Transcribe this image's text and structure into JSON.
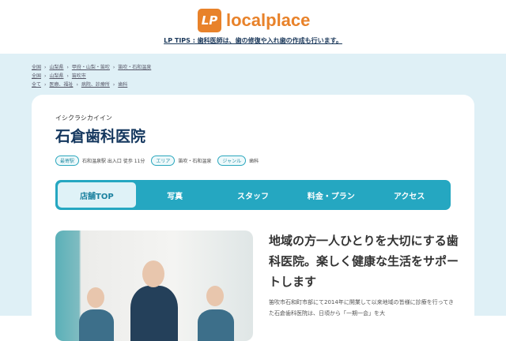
{
  "header": {
    "logo_mark": "LP",
    "logo_text": "localplace",
    "tips": "LP TIPS : 歯科医師は、歯の修復や入れ歯の作成も行います。"
  },
  "breadcrumbs": [
    [
      "全国",
      "山梨県",
      "甲府・山梨・笛吹",
      "笛吹・石和温泉"
    ],
    [
      "全国",
      "山梨県",
      "笛吹市"
    ],
    [
      "全て",
      "医療、福祉",
      "病院、診療所",
      "歯科"
    ]
  ],
  "clinic": {
    "kana": "イシクラシカイイン",
    "name": "石倉歯科医院",
    "tags": [
      {
        "label": "最寄駅",
        "value": "石和温泉駅 出入口 徒歩 11分"
      },
      {
        "label": "エリア",
        "value": "笛吹・石和温泉"
      },
      {
        "label": "ジャンル",
        "value": "歯科"
      }
    ]
  },
  "nav": [
    "店舗TOP",
    "写真",
    "スタッフ",
    "料金・プラン",
    "アクセス"
  ],
  "content": {
    "headline": "地域の方一人ひとりを大切にする歯科医院。楽しく健康な生活をサポートします",
    "description": "笛吹市石和町市部にて2014年に開業して以来地域の皆様に診療を行ってきた石倉歯科医院は、日頃から「一期一会」を大"
  }
}
